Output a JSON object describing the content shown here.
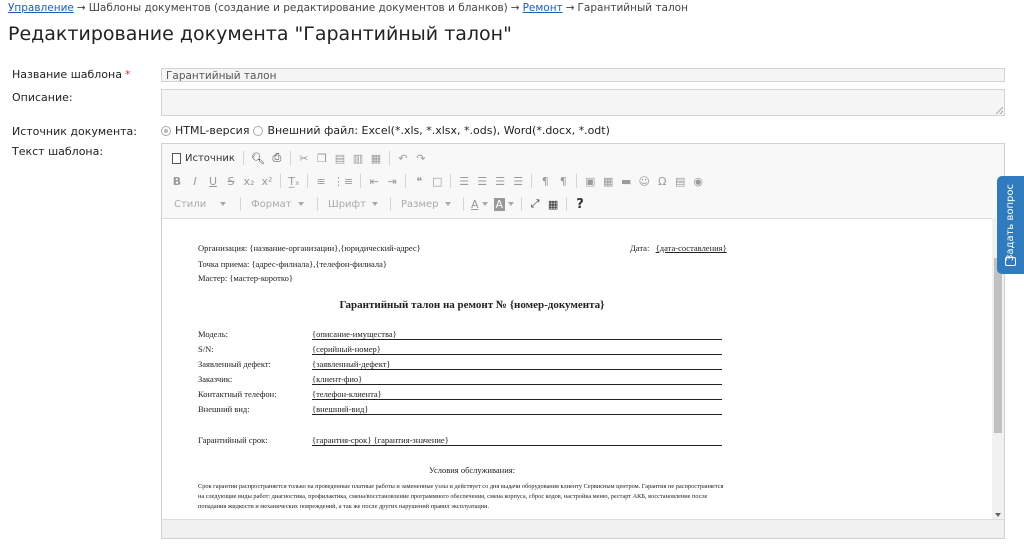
{
  "breadcrumb": {
    "item1": "Управление",
    "sep": "→",
    "item2": "Шаблоны документов (создание и редактирование документов и бланков)",
    "item3": "Ремонт",
    "item4": "Гарантийный талон"
  },
  "page_title": "Редактирование документа \"Гарантийный талон\"",
  "form": {
    "name_label": "Название шаблона",
    "required_mark": "*",
    "name_value": "Гарантийный талон",
    "desc_label": "Описание:",
    "desc_value": "",
    "source_label": "Источник документа:",
    "source_opt1": "HTML-версия",
    "source_opt2": "Внешний файл: Excel(*.xls, *.xlsx, *.ods), Word(*.docx, *.odt)",
    "text_label": "Текст шаблона:"
  },
  "toolbar": {
    "source": "Источник",
    "bold": "B",
    "italic": "I",
    "underline": "U",
    "strike": "S",
    "subscript": "x₂",
    "superscript": "x²",
    "remove_format": "T̲ₓ",
    "styles": "Стили",
    "format": "Формат",
    "font": "Шрифт",
    "size": "Размер",
    "text_color": "A",
    "bg_color": "A",
    "help": "?"
  },
  "doc": {
    "org_line": "Организация: {название-организации},{юридический-адрес}",
    "date_label": "Дата:",
    "date_value": "{дата-составления}",
    "point_line": "Точка приема: {адрес-филиала},{телефон-филиала}",
    "master_line": "Мастер: {мастер-коротко}",
    "title": "Гарантийный талон на ремонт №  {номер-документа}",
    "fields": [
      {
        "label": "Модель:",
        "value": "{описание-имущества}"
      },
      {
        "label": "S/N:",
        "value": "{серийный-номер}"
      },
      {
        "label": "Заявленный дефект:",
        "value": "{заявленный-дефект}"
      },
      {
        "label": "Заказчик:",
        "value": "{клиент-фио}"
      },
      {
        "label": "Контактный телефон:",
        "value": "{телефон-клиента}"
      },
      {
        "label": "Внешний вид:",
        "value": "{внешний-вид}"
      }
    ],
    "warranty_label": "Гарантийный срок:",
    "warranty_value": "{гарантия-срок} {гарантия-значение}",
    "conditions_title": "Условия обслуживания:",
    "terms": "Срок гарантии распространяется только на проведенные платные работы и замененные узлы и действует со дня выдачи оборудования клиенту Сервисным центром. Гарантия не распространяется на следующие виды работ: диагностика, профилактика, смена/восстановление программного обеспечения, смена корпуса, сброс кодов, настройка меню, рестарт АКБ, восстановление после попадания жидкости и механических повреждений, а так же после других нарушений правил эксплуатации."
  },
  "side_tab": {
    "label": "Задать вопрос"
  }
}
